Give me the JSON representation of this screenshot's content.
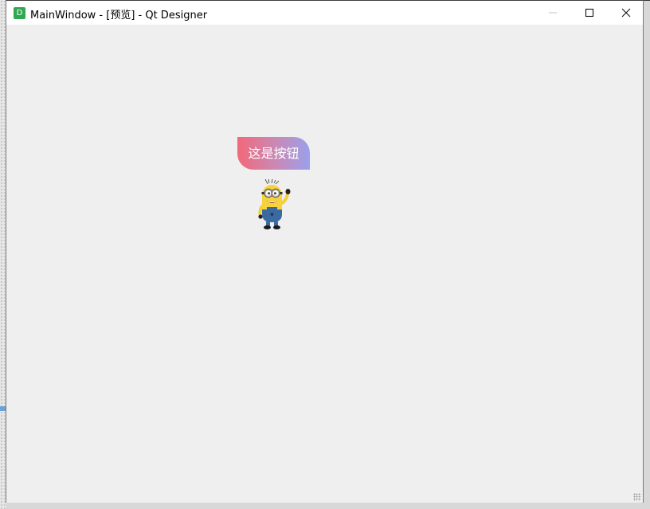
{
  "window": {
    "title": "MainWindow - [预览] - Qt Designer",
    "app_icon_letter": "D",
    "controls": [
      "minimize-icon",
      "maximize-icon",
      "close-icon"
    ]
  },
  "client": {
    "button_label": "这是按钮",
    "button_gradient": [
      "#f2687a",
      "#c88ab7",
      "#9aa0ec"
    ],
    "image": "minion-icon"
  },
  "colors": {
    "client_bg": "#efeff0",
    "app_icon": "#2fa84f"
  }
}
